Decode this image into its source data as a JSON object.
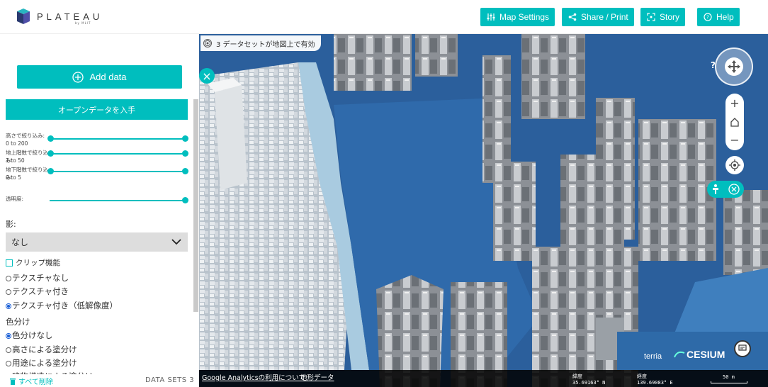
{
  "header": {
    "logo_text": "PLATEAU",
    "logo_sub": "by MLIT",
    "buttons": [
      {
        "label": "Map Settings",
        "icon": "sliders-icon"
      },
      {
        "label": "Share / Print",
        "icon": "share-icon"
      },
      {
        "label": "Story",
        "icon": "story-icon"
      },
      {
        "label": "Help",
        "icon": "help-icon"
      }
    ]
  },
  "sidebar": {
    "add_data": "Add data",
    "open_data": "オープンデータを入手",
    "sliders": [
      {
        "label": "高さで絞り込み:",
        "range": "0 to 200"
      },
      {
        "label": "地上階数で絞り込み:",
        "range": "1 to 50"
      },
      {
        "label": "地下階数で絞り込み:",
        "range": "0 to 5"
      }
    ],
    "opacity_label": "透明度:",
    "shadow_label": "影:",
    "shadow_value": "なし",
    "clip_label": "クリップ機能",
    "texture_options": [
      "テクスチャなし",
      "テクスチャ付き",
      "テクスチャ付き（低解像度）"
    ],
    "texture_selected": 2,
    "color_label": "色分け",
    "color_options": [
      "色分けなし",
      "高さによる塗分け",
      "用途による塗分け",
      "建物構造による塗分け"
    ],
    "color_selected": 0,
    "remove_all": "すべて削除",
    "datasets_count": "DATA SETS 3"
  },
  "map": {
    "dataset_pill": "3 データセットが地図上で有効",
    "help_q": "?",
    "attribution_terria": "terria",
    "attribution_cesium": "CESIUM",
    "links": [
      "Google Analyticsの利用について",
      "地形データ"
    ],
    "lat_label": "緯度",
    "lat_value": "35.69163° N",
    "lon_label": "経度",
    "lon_value": "139.69083° E",
    "scale": "50 m"
  },
  "colors": {
    "accent": "#00bebe",
    "water": "#2a5d99"
  }
}
